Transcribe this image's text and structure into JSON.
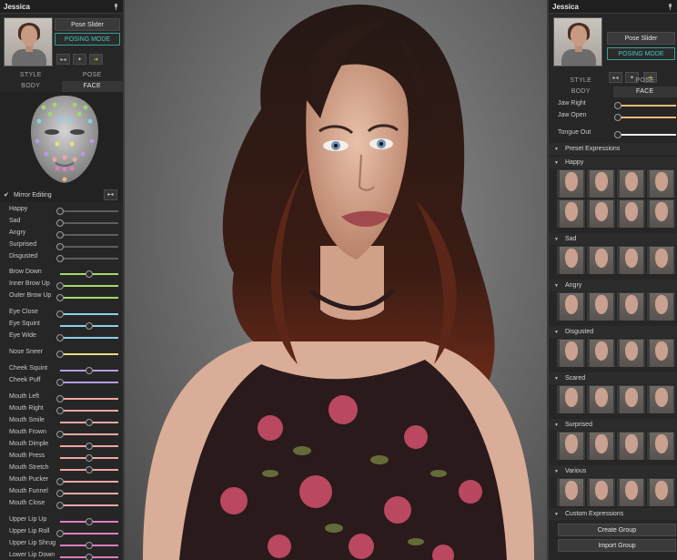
{
  "character_name": "Jessica",
  "left": {
    "pose_slider_label": "Pose Slider",
    "posing_mode_label": "POSING MODE",
    "tabs_top": [
      "STYLE",
      "POSE"
    ],
    "tabs_bottom": [
      "BODY",
      "FACE"
    ],
    "active_bottom_tab": "FACE",
    "mirror_label": "Mirror Editing",
    "mirror_checked": true,
    "emotions": [
      {
        "label": "Happy",
        "value": 0
      },
      {
        "label": "Sad",
        "value": 0
      },
      {
        "label": "Angry",
        "value": 0
      },
      {
        "label": "Surprised",
        "value": 0
      },
      {
        "label": "Disgusted",
        "value": 0
      }
    ],
    "muscles": [
      {
        "label": "Brow Down",
        "value": 0.5,
        "color": "#a6d86a",
        "bipolar": true
      },
      {
        "label": "Inner Brow Up",
        "value": 0,
        "color": "#a6d86a",
        "bipolar": false
      },
      {
        "label": "Outer Brow Up",
        "value": 0,
        "color": "#a6d86a",
        "bipolar": false
      },
      {
        "label": "Eye Close",
        "value": 0,
        "color": "#8ad0ea",
        "bipolar": false
      },
      {
        "label": "Eye Squint",
        "value": 0.5,
        "color": "#8ad0ea",
        "bipolar": true
      },
      {
        "label": "Eye Wide",
        "value": 0,
        "color": "#8ad0ea",
        "bipolar": false
      },
      {
        "label": "Nose Sneer",
        "value": 0,
        "color": "#e6e07c",
        "bipolar": false
      },
      {
        "label": "Cheek Squint",
        "value": 0.5,
        "color": "#b79be8",
        "bipolar": true
      },
      {
        "label": "Cheek Puff",
        "value": 0,
        "color": "#b79be8",
        "bipolar": false
      },
      {
        "label": "Mouth Left",
        "value": 0,
        "color": "#f0a6a6",
        "bipolar": false
      },
      {
        "label": "Mouth Right",
        "value": 0,
        "color": "#f0a6a6",
        "bipolar": false
      },
      {
        "label": "Mouth Smile",
        "value": 0.5,
        "color": "#f0a6a6",
        "bipolar": true
      },
      {
        "label": "Mouth Frown",
        "value": 0,
        "color": "#f0a6a6",
        "bipolar": false
      },
      {
        "label": "Mouth Dimple",
        "value": 0.5,
        "color": "#f0a6a6",
        "bipolar": true
      },
      {
        "label": "Mouth Press",
        "value": 0.5,
        "color": "#f0a6a6",
        "bipolar": true
      },
      {
        "label": "Mouth Stretch",
        "value": 0.5,
        "color": "#f0a6a6",
        "bipolar": true
      },
      {
        "label": "Mouth Pucker",
        "value": 0,
        "color": "#f0a6a6",
        "bipolar": false
      },
      {
        "label": "Mouth Funnel",
        "value": 0,
        "color": "#f0a6a6",
        "bipolar": false
      },
      {
        "label": "Mouth Close",
        "value": 0,
        "color": "#f0a6a6",
        "bipolar": false
      },
      {
        "label": "Upper Lip Up",
        "value": 0.5,
        "color": "#e07cc2",
        "bipolar": true
      },
      {
        "label": "Upper Lip Roll",
        "value": 0,
        "color": "#e07cc2",
        "bipolar": false
      },
      {
        "label": "Upper Lip Shrug",
        "value": 0.5,
        "color": "#e07cc2",
        "bipolar": true
      },
      {
        "label": "Lower Lip Down",
        "value": 0.5,
        "color": "#e07cc2",
        "bipolar": true
      }
    ]
  },
  "right": {
    "pose_slider_label": "Pose Slider",
    "posing_mode_label": "POSING MODE",
    "tabs_top": [
      "STYLE",
      "POSE"
    ],
    "tabs_bottom": [
      "BODY",
      "FACE"
    ],
    "active_bottom_tab": "FACE",
    "sliders": [
      {
        "label": "Jaw Right",
        "value": 0,
        "color": "#f2b87a"
      },
      {
        "label": "Jaw Open",
        "value": 0,
        "color": "#f2b87a"
      },
      {
        "label": "Tongue Out",
        "value": 0,
        "color": "#eeeeee"
      }
    ],
    "preset_header": "Preset Expressions",
    "groups": [
      {
        "label": "Happy",
        "count": 8
      },
      {
        "label": "Sad",
        "count": 4
      },
      {
        "label": "Angry",
        "count": 4
      },
      {
        "label": "Disgusted",
        "count": 4
      },
      {
        "label": "Scared",
        "count": 4
      },
      {
        "label": "Surprised",
        "count": 4
      },
      {
        "label": "Various",
        "count": 4
      }
    ],
    "custom_header": "Custom Expressions",
    "create_group_label": "Create Group",
    "import_group_label": "Import Group"
  },
  "colors": {
    "accent_teal": "#3fc3bf",
    "panel_bg": "#262626",
    "active_tool": "#e8c03b"
  },
  "icons": [
    "pin-icon",
    "pose-icon",
    "arrow-icon",
    "mirror-icon",
    "chevron-down-icon"
  ]
}
